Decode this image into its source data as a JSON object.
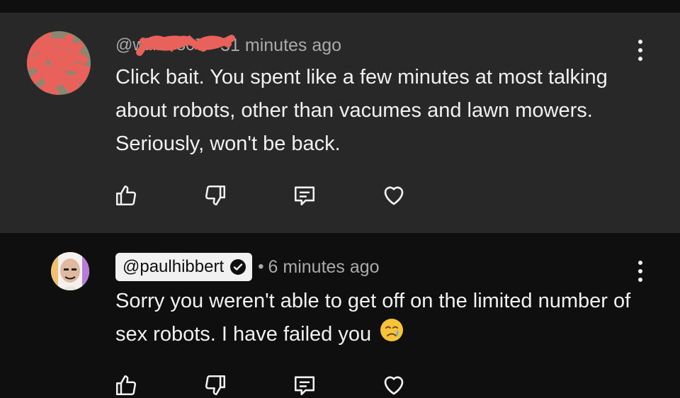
{
  "comments": [
    {
      "handle": "@willilli 307",
      "separator": "•",
      "time": "31 minutes ago",
      "text": "Click bait. You spent like a few minutes at most talking about robots, other than vacumes and lawn mowers. Seriously, won't be back."
    },
    {
      "handle": "@paulhibbert",
      "separator": "•",
      "time": "6 minutes ago",
      "text": "Sorry you weren't able to get off on the limited number of sex robots. I have failed you"
    }
  ],
  "icons": {
    "like": "thumbs-up-icon",
    "dislike": "thumbs-down-icon",
    "reply": "comment-icon",
    "heart": "heart-icon",
    "more": "more-vertical-icon",
    "verified": "verified-check-icon",
    "emoji": "crying-face-emoji"
  },
  "colors": {
    "top_bg": "#282828",
    "page_bg": "#0f0f0f",
    "text": "#f1f1f1",
    "muted": "#aaaaaa",
    "redaction": "#e8615a"
  }
}
